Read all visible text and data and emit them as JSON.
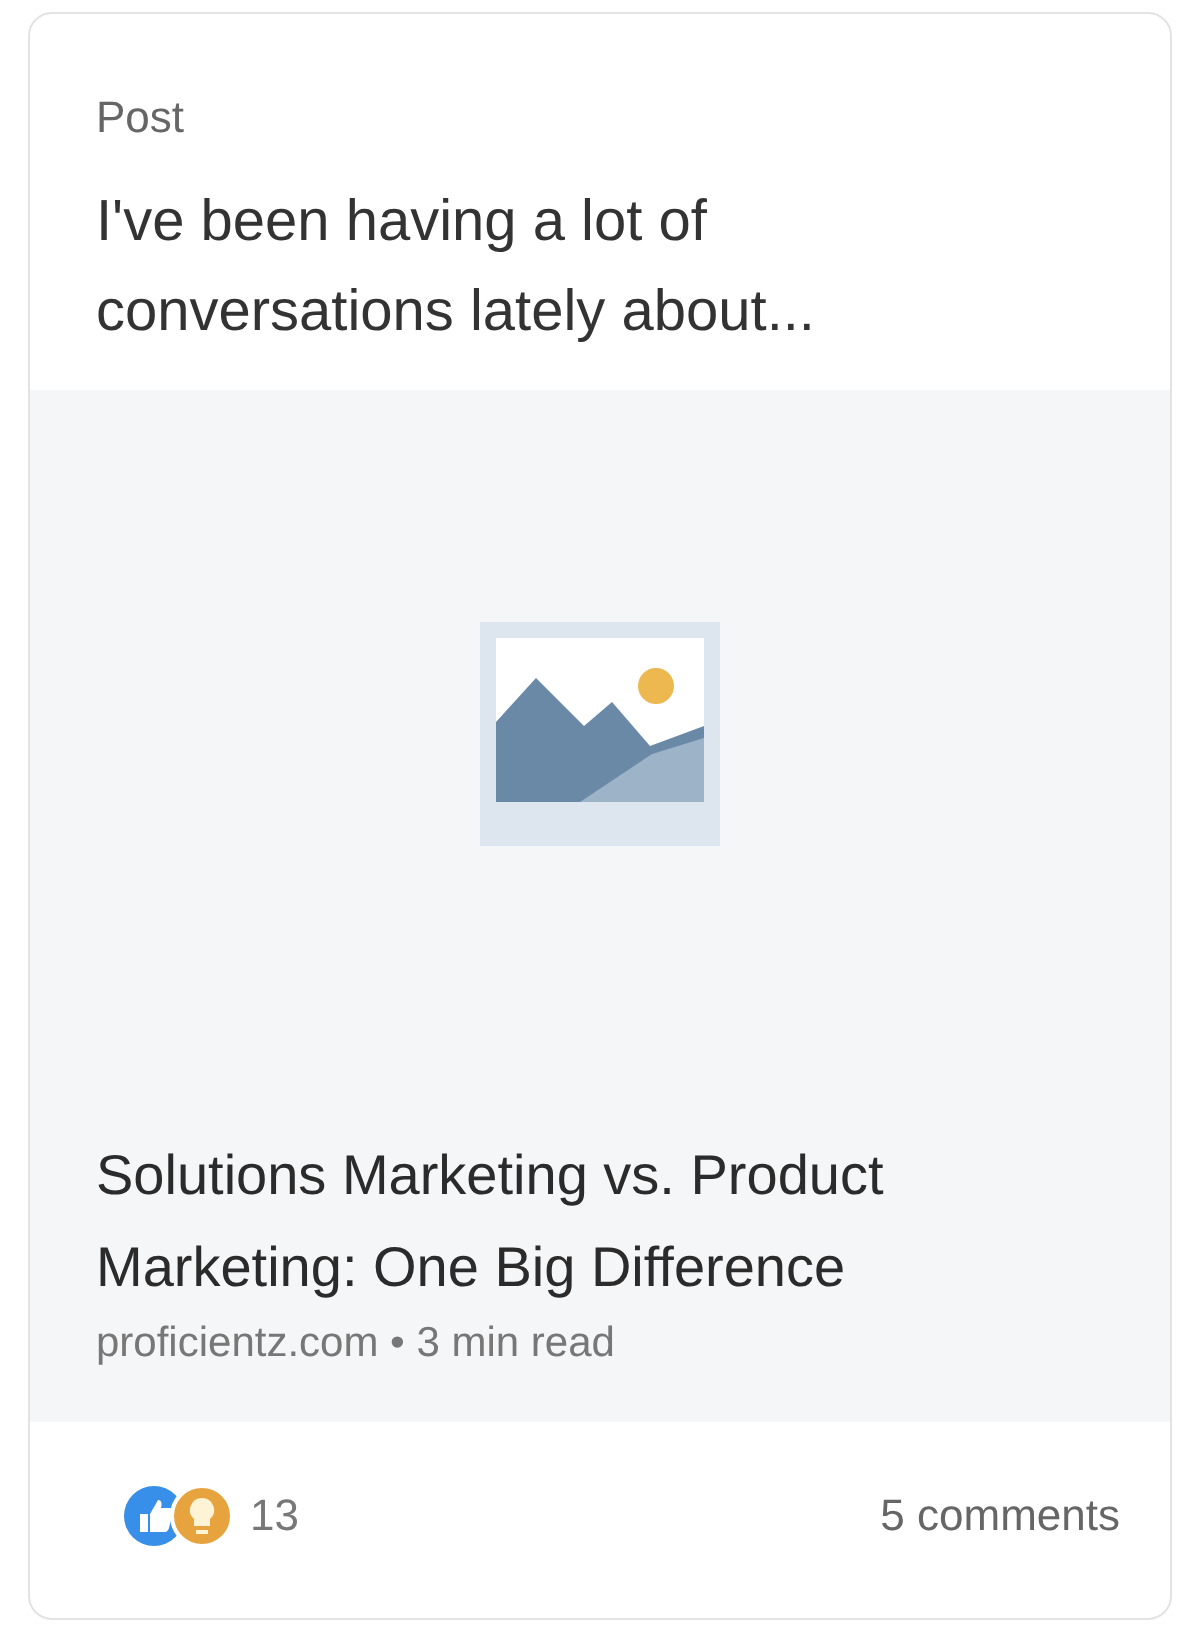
{
  "card": {
    "type_label": "Post",
    "text": "I've been having a lot of conversations lately about...",
    "link_preview": {
      "title": "Solutions Marketing vs. Product Marketing: One Big Difference",
      "meta": "proficientz.com • 3 min read"
    },
    "reactions_count": "13",
    "comments": "5 comments"
  }
}
